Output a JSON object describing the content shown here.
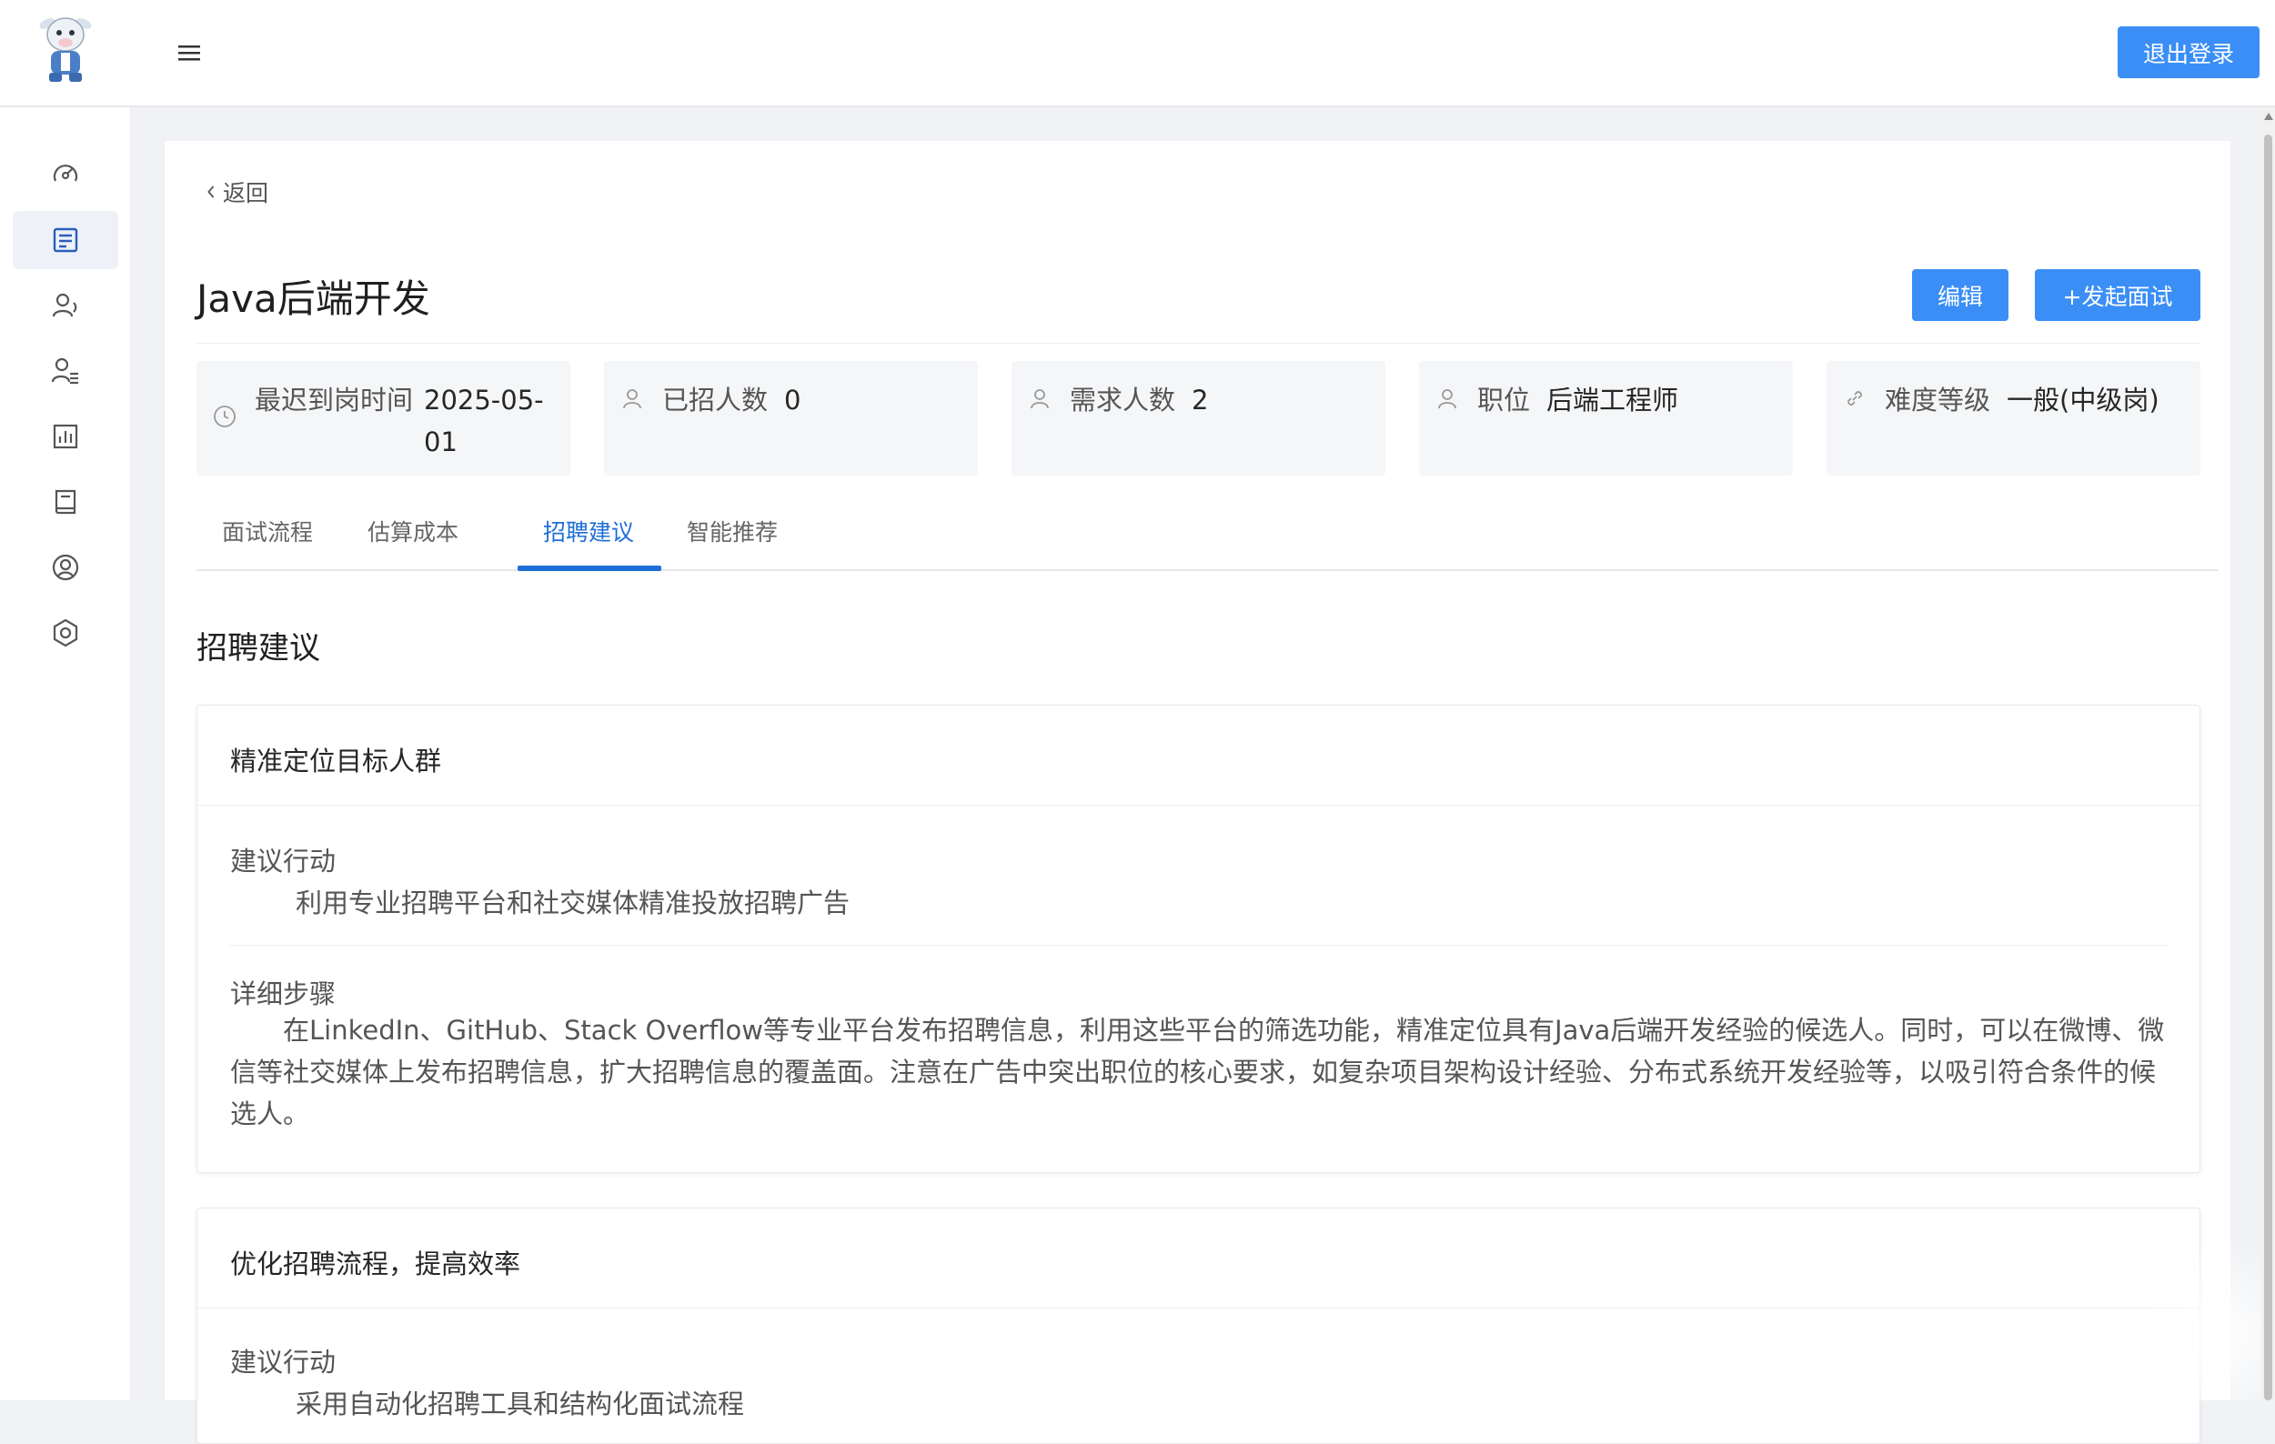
{
  "header": {
    "logout_label": "退出登录",
    "accent_color": "#3a8ef6"
  },
  "sidebar": {
    "items": [
      {
        "icon": "dashboard-icon",
        "active": false
      },
      {
        "icon": "document-icon",
        "active": true
      },
      {
        "icon": "user-voice-icon",
        "active": false
      },
      {
        "icon": "user-list-icon",
        "active": false
      },
      {
        "icon": "bar-chart-icon",
        "active": false
      },
      {
        "icon": "book-icon",
        "active": false
      },
      {
        "icon": "user-circle-icon",
        "active": false
      },
      {
        "icon": "settings-hexagon-icon",
        "active": false
      }
    ]
  },
  "main": {
    "back_label": "返回",
    "title": "Java后端开发",
    "edit_label": "编辑",
    "start_interview_label": "+发起面试",
    "info_cards": [
      {
        "icon": "clock-icon",
        "label": "最迟到岗时间",
        "value": "2025-05-01"
      },
      {
        "icon": "person-icon",
        "label": "已招人数",
        "value": "0"
      },
      {
        "icon": "person-icon",
        "label": "需求人数",
        "value": "2"
      },
      {
        "icon": "person-icon",
        "label": "职位",
        "value": "后端工程师"
      },
      {
        "icon": "link-icon",
        "label": "难度等级",
        "value": "一般(中级岗)"
      }
    ],
    "tabs": [
      "面试流程",
      "估算成本",
      "招聘建议",
      "智能推荐"
    ],
    "active_tab": "招聘建议",
    "section_title": "招聘建议",
    "suggestions": [
      {
        "title": "精准定位目标人群",
        "action_label": "建议行动",
        "action": "利用专业招聘平台和社交媒体精准投放招聘广告",
        "steps_label": "详细步骤",
        "steps": "在LinkedIn、GitHub、Stack Overflow等专业平台发布招聘信息，利用这些平台的筛选功能，精准定位具有Java后端开发经验的候选人。同时，可以在微博、微信等社交媒体上发布招聘信息，扩大招聘信息的覆盖面。注意在广告中突出职位的核心要求，如复杂项目架构设计经验、分布式系统开发经验等，以吸引符合条件的候选人。"
      },
      {
        "title": "优化招聘流程，提高效率",
        "action_label": "建议行动",
        "action": "采用自动化招聘工具和结构化面试流程"
      }
    ]
  }
}
